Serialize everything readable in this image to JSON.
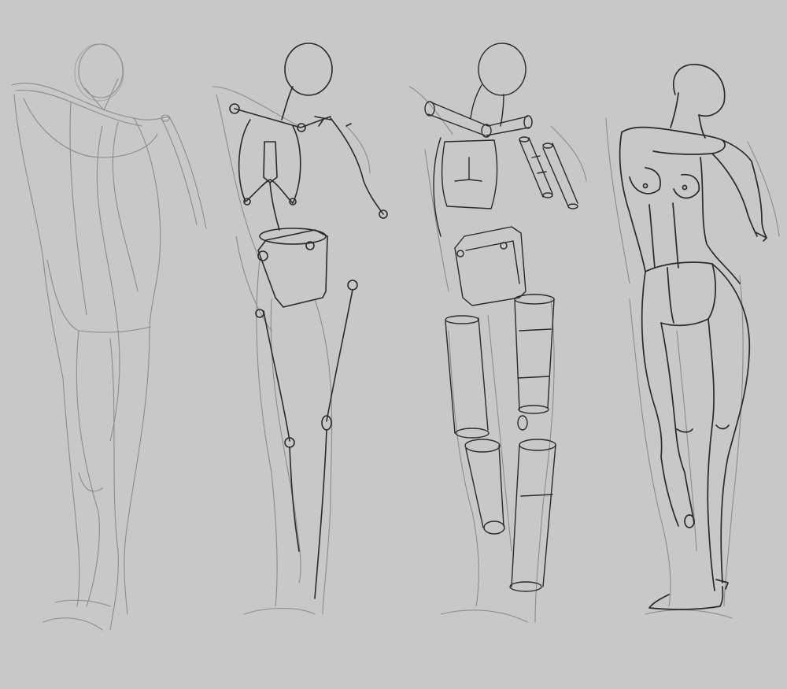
{
  "artwork": {
    "subject": "figure-drawing-construction-stages",
    "background_color": "#c8c8c8",
    "light_stroke_color": "#8c8c8c",
    "dark_stroke_color": "#2a2a2a",
    "figures": [
      {
        "stage": "gesture"
      },
      {
        "stage": "skeleton"
      },
      {
        "stage": "mannequin"
      },
      {
        "stage": "refined-form"
      }
    ]
  }
}
